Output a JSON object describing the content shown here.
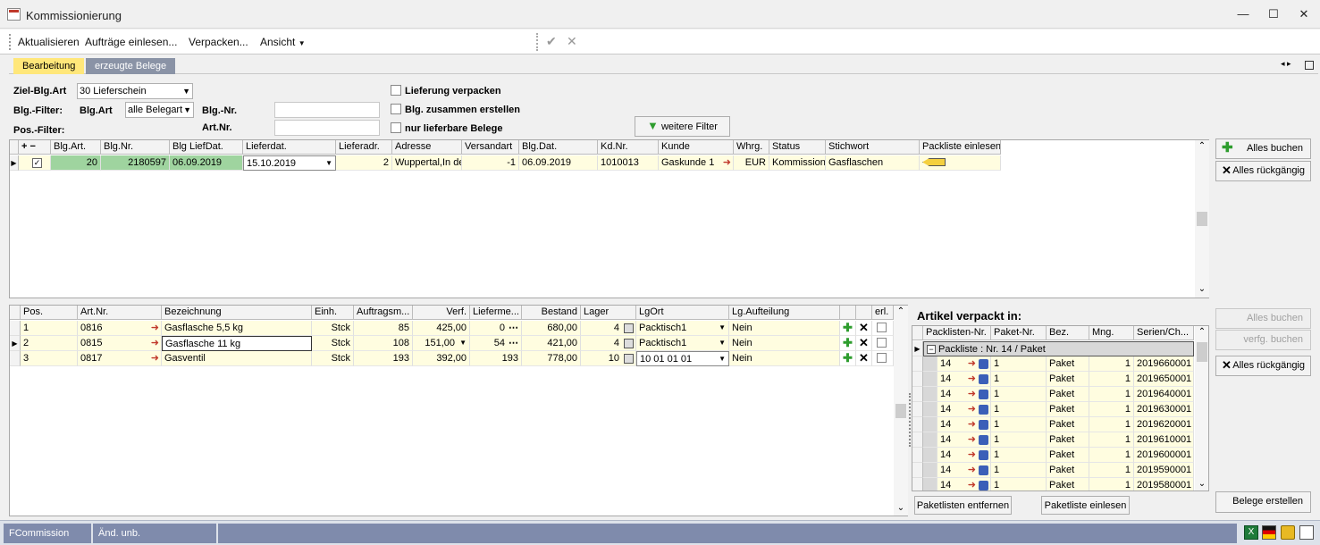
{
  "window": {
    "title": "Kommissionierung"
  },
  "menu": {
    "items": [
      "Aktualisieren",
      "Aufträge einlesen...",
      "Verpacken...",
      "Ansicht"
    ]
  },
  "tabs": [
    "Bearbeitung",
    "erzeugte Belege"
  ],
  "filters": {
    "ziel_label": "Ziel-Blg.Art",
    "ziel_value": "30 Lieferschein",
    "blg_filter_label": "Blg.-Filter:",
    "blgart_label": "Blg.Art",
    "blgart_value": "alle Belegart",
    "blgnr_label": "Blg.-Nr.",
    "pos_filter_label": "Pos.-Filter:",
    "artnr_label": "Art.Nr.",
    "chk_lieferung": "Lieferung verpacken",
    "chk_zusammen": "Blg. zusammen erstellen",
    "chk_lieferbar": "nur lieferbare Belege",
    "weitere_filter": "weitere Filter"
  },
  "top_grid": {
    "headers": [
      "+ −",
      "Blg.Art.",
      "Blg.Nr.",
      "Blg LiefDat.",
      "Lieferdat.",
      "Lieferadr.",
      "Adresse",
      "Versandart",
      "Blg.Dat.",
      "Kd.Nr.",
      "Kunde",
      "Whrg.",
      "Status",
      "Stichwort",
      "Packliste einlesen"
    ],
    "rows": [
      {
        "blgart": "20",
        "blgnr": "2180597",
        "blgliefdat": "06.09.2019",
        "lieferdat": "15.10.2019",
        "lieferadr": "2",
        "adresse": "Wuppertal,In de",
        "versandart": "-1",
        "blgdat": "06.09.2019",
        "kdnr": "1010013",
        "kunde": "Gaskunde 1",
        "whrg": "EUR",
        "status": "Kommissionie",
        "stichwort": "Gasflaschen"
      }
    ]
  },
  "right_buttons_top": {
    "alles_buchen": "Alles buchen",
    "alles_rueckgaengig": "Alles rückgängig"
  },
  "pos_grid": {
    "headers": [
      "Pos.",
      "Art.Nr.",
      "Bezeichnung",
      "Einh.",
      "Auftragsm...",
      "Verf.",
      "Lieferme...",
      "Bestand",
      "Lager",
      "LgOrt",
      "Lg.Aufteilung",
      "",
      "",
      "erl."
    ],
    "rows": [
      {
        "pos": "1",
        "artnr": "0816",
        "bez": "Gasflasche 5,5 kg",
        "einh": "Stck",
        "auftrag": "85",
        "verf": "425,00",
        "liefer": "0",
        "bestand": "680,00",
        "lager": "4",
        "lgort": "Packtisch1",
        "aufteilung": "Nein"
      },
      {
        "pos": "2",
        "artnr": "0815",
        "bez": "Gasflasche 11 kg",
        "einh": "Stck",
        "auftrag": "108",
        "verf": "151,00",
        "liefer": "54",
        "bestand": "421,00",
        "lager": "4",
        "lgort": "Packtisch1",
        "aufteilung": "Nein"
      },
      {
        "pos": "3",
        "artnr": "0817",
        "bez": "Gasventil",
        "einh": "Stck",
        "auftrag": "193",
        "verf": "392,00",
        "liefer": "193",
        "bestand": "778,00",
        "lager": "10",
        "lgort": "10 01 01 01",
        "aufteilung": "Nein"
      }
    ]
  },
  "packed": {
    "title": "Artikel verpackt in:",
    "headers": [
      "Packlisten-Nr.",
      "Paket-Nr.",
      "Bez.",
      "Mng.",
      "Serien/Ch..."
    ],
    "group": "Packliste : Nr. 14 / Paket",
    "rows": [
      {
        "pl": "14",
        "paket": "1",
        "bez": "Paket",
        "mng": "1",
        "serie": "2019660001"
      },
      {
        "pl": "14",
        "paket": "1",
        "bez": "Paket",
        "mng": "1",
        "serie": "2019650001"
      },
      {
        "pl": "14",
        "paket": "1",
        "bez": "Paket",
        "mng": "1",
        "serie": "2019640001"
      },
      {
        "pl": "14",
        "paket": "1",
        "bez": "Paket",
        "mng": "1",
        "serie": "2019630001"
      },
      {
        "pl": "14",
        "paket": "1",
        "bez": "Paket",
        "mng": "1",
        "serie": "2019620001"
      },
      {
        "pl": "14",
        "paket": "1",
        "bez": "Paket",
        "mng": "1",
        "serie": "2019610001"
      },
      {
        "pl": "14",
        "paket": "1",
        "bez": "Paket",
        "mng": "1",
        "serie": "2019600001"
      },
      {
        "pl": "14",
        "paket": "1",
        "bez": "Paket",
        "mng": "1",
        "serie": "2019590001"
      },
      {
        "pl": "14",
        "paket": "1",
        "bez": "Paket",
        "mng": "1",
        "serie": "2019580001"
      }
    ],
    "btn_entfernen": "Paketlisten entfernen",
    "btn_einlesen": "Paketliste einlesen"
  },
  "right_buttons_bottom": {
    "alles_buchen": "Alles buchen",
    "verfg_buchen": "verfg. buchen",
    "alles_rueckgaengig": "Alles rückgängig",
    "belege_erstellen": "Belege erstellen"
  },
  "status": {
    "form": "FCommission",
    "state": "Änd. unb."
  }
}
